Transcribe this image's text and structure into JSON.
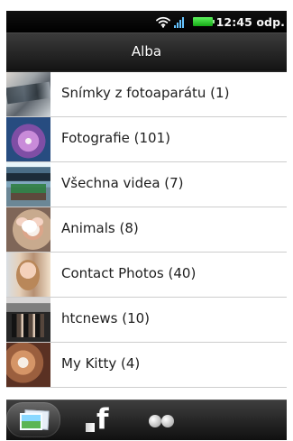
{
  "status_bar": {
    "time": "12:45 odp.",
    "icons": [
      "wifi-icon",
      "signal-icon",
      "battery-icon"
    ],
    "battery_color": "#1fd21f"
  },
  "header": {
    "title": "Alba"
  },
  "albums": [
    {
      "label": "Snímky z fotoaparátu (1)",
      "thumbnail": "camera-roll-thumbnail"
    },
    {
      "label": "Fotografie (101)",
      "thumbnail": "flower-thumbnail"
    },
    {
      "label": "Všechna videa (7)",
      "thumbnail": "video-scene-thumbnail"
    },
    {
      "label": "Animals (8)",
      "thumbnail": "animals-thumbnail"
    },
    {
      "label": "Contact Photos (40)",
      "thumbnail": "contact-photo-thumbnail"
    },
    {
      "label": "htcnews (10)",
      "thumbnail": "htcnews-thumbnail"
    },
    {
      "label": "My Kitty (4)",
      "thumbnail": "kitty-thumbnail"
    }
  ],
  "bottom_tabs": [
    {
      "name": "albums",
      "icon": "albums-icon",
      "selected": true
    },
    {
      "name": "facebook",
      "icon": "facebook-icon",
      "letter": "f"
    },
    {
      "name": "flickr",
      "icon": "flickr-icon"
    }
  ],
  "colors": {
    "selected_tab_background": "#4b4b4b",
    "title_text": "#ffffff",
    "row_text": "#1e1e1e",
    "divider": "#cdcdcd"
  }
}
